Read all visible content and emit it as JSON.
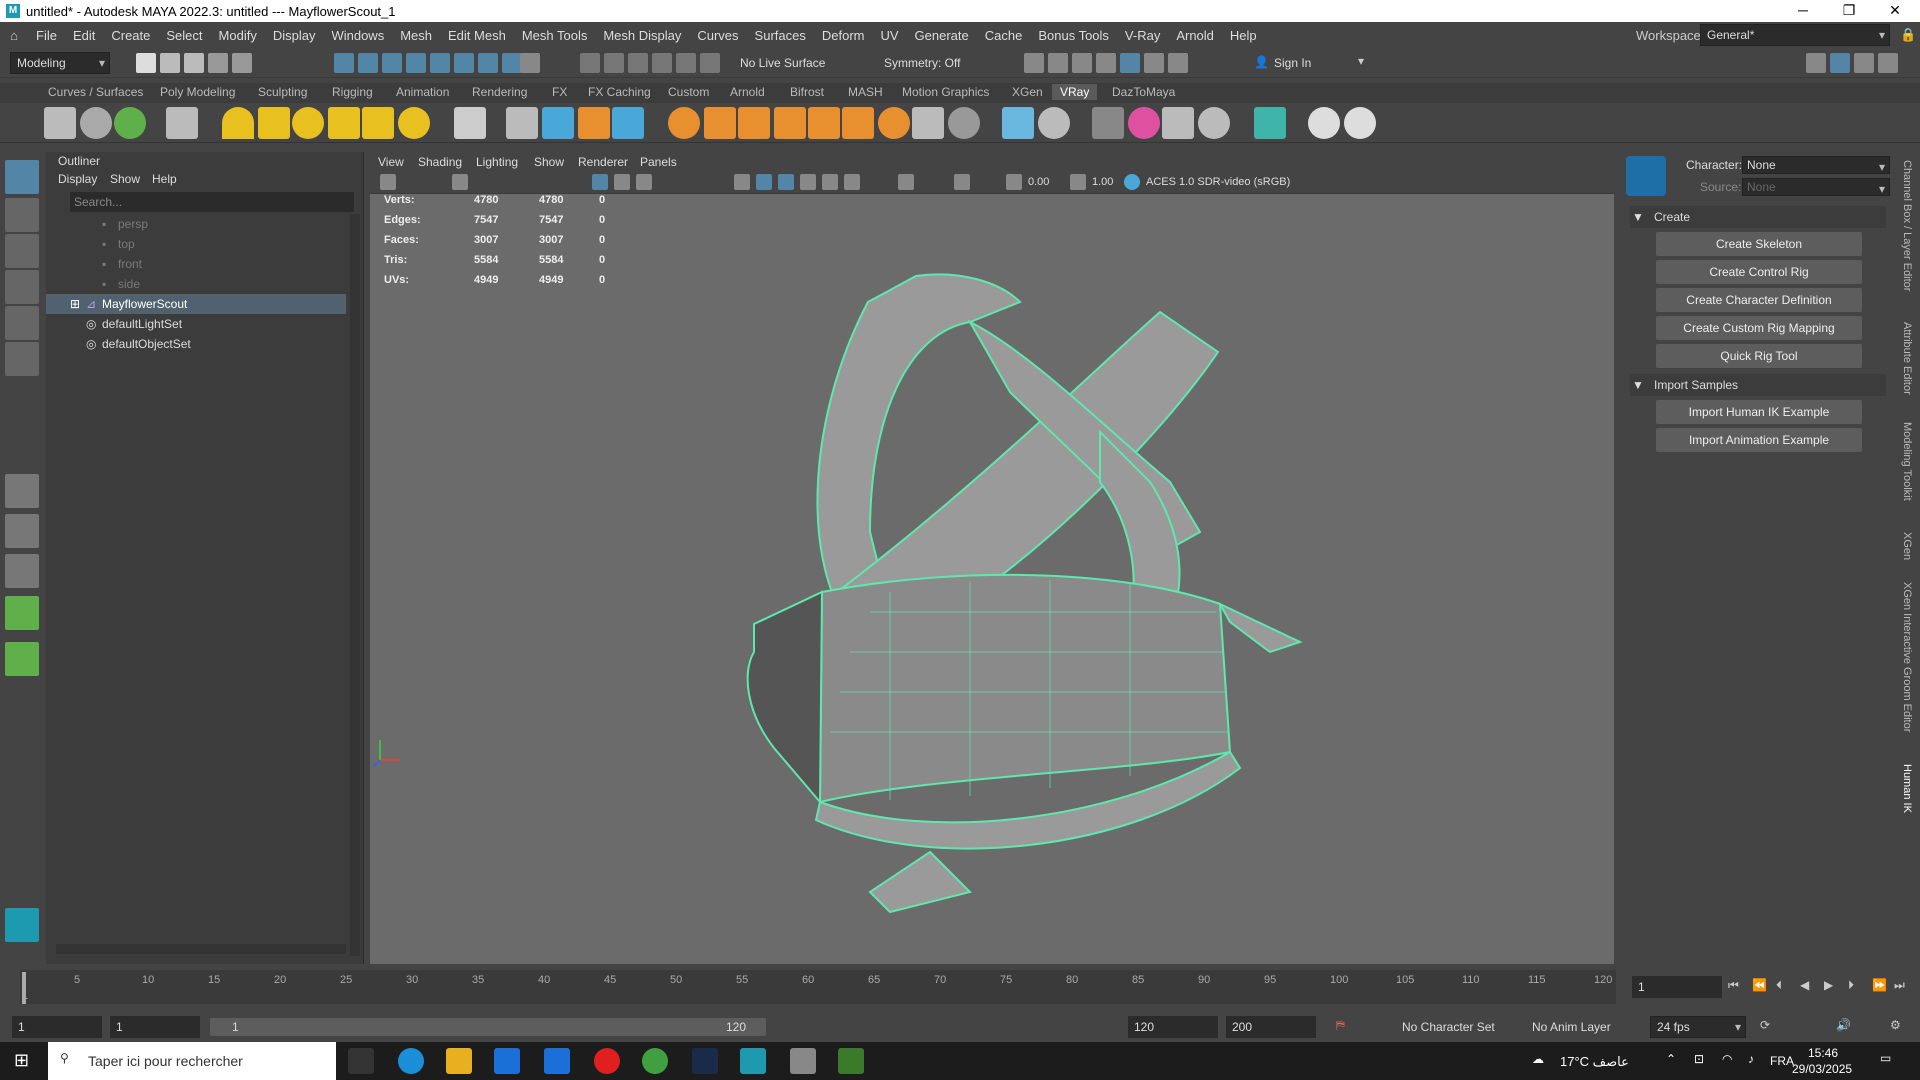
{
  "window": {
    "title": "untitled* - Autodesk MAYA 2022.3: untitled  ---  MayflowerScout_1",
    "workspace_label": "Workspace:",
    "workspace_value": "General*"
  },
  "menu": [
    "File",
    "Edit",
    "Create",
    "Select",
    "Modify",
    "Display",
    "Windows",
    "Mesh",
    "Edit Mesh",
    "Mesh Tools",
    "Mesh Display",
    "Curves",
    "Surfaces",
    "Deform",
    "UV",
    "Generate",
    "Cache",
    "Bonus Tools",
    "V-Ray",
    "Arnold",
    "Help"
  ],
  "status": {
    "mode": "Modeling",
    "live_surface": "No Live Surface",
    "symmetry": "Symmetry: Off",
    "sign_in": "Sign In"
  },
  "shelf_tabs": [
    "Curves / Surfaces",
    "Poly Modeling",
    "Sculpting",
    "Rigging",
    "Animation",
    "Rendering",
    "FX",
    "FX Caching",
    "Custom",
    "Arnold",
    "Bifrost",
    "MASH",
    "Motion Graphics",
    "XGen",
    "VRay",
    "DazToMaya"
  ],
  "active_shelf": "VRay",
  "outliner": {
    "title": "Outliner",
    "menu": [
      "Display",
      "Show",
      "Help"
    ],
    "search_placeholder": "Search...",
    "items": [
      {
        "label": "persp",
        "dim": true
      },
      {
        "label": "top",
        "dim": true
      },
      {
        "label": "front",
        "dim": true
      },
      {
        "label": "side",
        "dim": true
      },
      {
        "label": "MayflowerScout",
        "selected": true
      },
      {
        "label": "defaultLightSet"
      },
      {
        "label": "defaultObjectSet"
      }
    ]
  },
  "viewport": {
    "menu": [
      "View",
      "Shading",
      "Lighting",
      "Show",
      "Renderer",
      "Panels"
    ],
    "exposure": "0.00",
    "gamma": "1.00",
    "colorspace": "ACES 1.0 SDR-video (sRGB)",
    "stats": [
      {
        "label": "Verts:",
        "a": "4780",
        "b": "4780",
        "c": "0"
      },
      {
        "label": "Edges:",
        "a": "7547",
        "b": "7547",
        "c": "0"
      },
      {
        "label": "Faces:",
        "a": "3007",
        "b": "3007",
        "c": "0"
      },
      {
        "label": "Tris:",
        "a": "5584",
        "b": "5584",
        "c": "0"
      },
      {
        "label": "UVs:",
        "a": "4949",
        "b": "4949",
        "c": "0"
      }
    ]
  },
  "hik": {
    "character_label": "Character:",
    "character_value": "None",
    "source_label": "Source:",
    "source_value": "None",
    "create_section": "Create",
    "create_buttons": [
      "Create Skeleton",
      "Create Control Rig",
      "Create Character Definition",
      "Create Custom Rig Mapping",
      "Quick Rig Tool"
    ],
    "import_section": "Import Samples",
    "import_buttons": [
      "Import Human IK Example",
      "Import Animation Example"
    ]
  },
  "side_tabs": [
    "Channel Box / Layer Editor",
    "Attribute Editor",
    "Modeling Toolkit",
    "XGen",
    "XGen Interactive Groom Editor",
    "Human IK"
  ],
  "timeline": {
    "ticks": [
      "5",
      "10",
      "15",
      "20",
      "25",
      "30",
      "35",
      "40",
      "45",
      "50",
      "55",
      "60",
      "65",
      "70",
      "75",
      "80",
      "85",
      "90",
      "95",
      "100",
      "105",
      "110",
      "115",
      "120"
    ],
    "current_frame": "1",
    "frame_marker": "1"
  },
  "range": {
    "start": "1",
    "playback_start": "1",
    "slider_start": "1",
    "slider_end": "120",
    "playback_end": "120",
    "end": "200",
    "character_set": "No Character Set",
    "anim_layer": "No Anim Layer",
    "fps": "24 fps"
  },
  "taskbar": {
    "search_placeholder": "Taper ici pour rechercher",
    "weather": "17°C عاصف",
    "lang": "FRA",
    "time": "15:46",
    "date": "29/03/2025"
  },
  "colors": {
    "accent": "#5285a6",
    "wire": "#5fe7b0",
    "panel": "#444444"
  }
}
